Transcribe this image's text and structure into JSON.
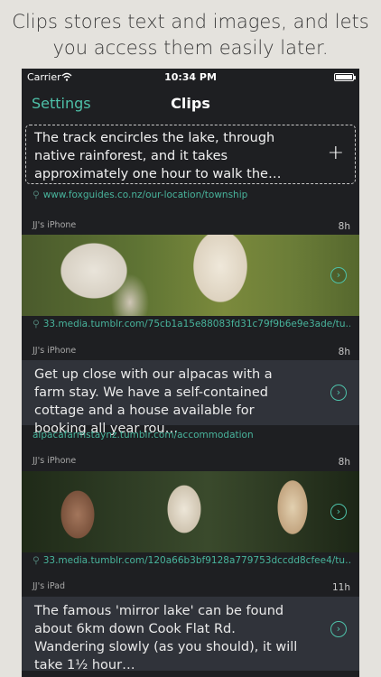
{
  "caption": {
    "line1": "Clips stores text and images, and lets",
    "line2": "you access them easily later."
  },
  "status_bar": {
    "carrier": "Carrier",
    "time": "10:34 PM"
  },
  "nav": {
    "left_label": "Settings",
    "title": "Clips"
  },
  "new_clip": {
    "text": "The track encircles the lake, through native rainforest, and it takes approximately one hour to walk the…",
    "link": "www.foxguides.co.nz/our-location/township",
    "add_label": "+"
  },
  "clips": [
    {
      "device": "JJ's iPhone",
      "age": "8h",
      "kind": "image",
      "link": "33.media.tumblr.com/75cb1a15e88083fd31c79f9b6e9e3ade/tu…"
    },
    {
      "device": "JJ's iPhone",
      "age": "8h",
      "kind": "text",
      "text": "Get up close with our alpacas with a farm stay. We have a self-contained cottage and a house available for booking all year rou…",
      "link": "alpacafarmstaynz.tumblr.com/accommodation"
    },
    {
      "device": "JJ's iPhone",
      "age": "8h",
      "kind": "image",
      "link": "33.media.tumblr.com/120a66b3bf9128a779753dccdd8cfee4/tu…"
    },
    {
      "device": "JJ's iPad",
      "age": "11h",
      "kind": "text",
      "text": "The famous 'mirror lake' can be found about 6km down Cook Flat Rd. Wandering slowly (as you should), it will take 1½ hour…"
    }
  ],
  "icons": {
    "open": "chevron-right-circle-icon",
    "link": "link-icon",
    "add": "plus-icon"
  },
  "colors": {
    "accent": "#4ec1a9",
    "background": "#1e1f22",
    "card": "#30333a"
  }
}
